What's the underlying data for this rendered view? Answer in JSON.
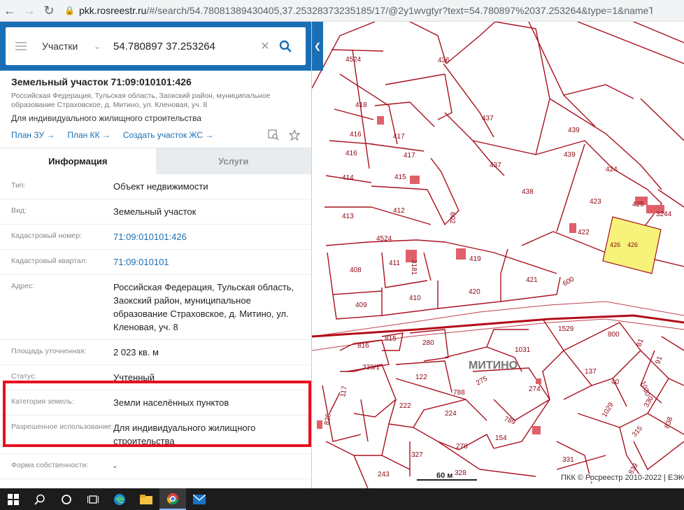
{
  "browser": {
    "url_host": "pkk.rosreestr.ru",
    "url_path": "/#/search/54.78081389430405,37.25328373235185/17/@2y1wvgtyr?text=54.780897%2037.253264&type=1&nameTab&i"
  },
  "search": {
    "type_label": "Участки",
    "query": "54.780897 37.253264"
  },
  "object": {
    "title": "Земельный участок 71:09:010101:426",
    "address_short": "Российская Федерация, Тульская область, Заокский район, муниципальное образование Страховское, д. Митино, ул. Кленовая, уч. 8",
    "use": "Для индивидуального жилищного строительства",
    "links": [
      "План ЗУ →",
      "План КК →",
      "Создать участок ЖС →"
    ]
  },
  "tabs": [
    "Информация",
    "Услуги"
  ],
  "info": [
    {
      "label": "Тип:",
      "value": "Объект недвижимости",
      "link": false
    },
    {
      "label": "Вид:",
      "value": "Земельный участок",
      "link": false
    },
    {
      "label": "Кадастровый номер:",
      "value": "71:09:010101:426",
      "link": true
    },
    {
      "label": "Кадастровый квартал:",
      "value": "71:09:010101",
      "link": true
    },
    {
      "label": "Адрес:",
      "value": "Российская Федерация, Тульская область, Заокский район, муниципальное образование Страховское, д. Митино, ул. Кленовая, уч. 8",
      "link": false
    },
    {
      "label": "Площадь уточненная:",
      "value": "2 023 кв. м",
      "link": false
    },
    {
      "label": "Статус:",
      "value": "Учтенный",
      "link": false
    },
    {
      "label": "Категория земель:",
      "value": "Земли населённых пунктов",
      "link": false
    },
    {
      "label": "Разрешенное использование:",
      "value": "Для индивидуального жилищного строительства",
      "link": false
    },
    {
      "label": "Форма собственности:",
      "value": "-",
      "link": false
    }
  ],
  "map": {
    "place_name": "МИТИНО",
    "scale_label": "60 м",
    "copyright": "ПКК © Росреестр 2010-2022 | ЕЭКО",
    "parcel_labels": [
      "4524",
      "436",
      "418",
      "416",
      "416",
      "417",
      "417",
      "437",
      "437",
      "439",
      "439",
      "424",
      "414",
      "415",
      "413",
      "412",
      "602",
      "438",
      "423",
      "425",
      "3244",
      "422",
      "426",
      "4524",
      "408",
      "411",
      "3181",
      "419",
      "421",
      "600",
      "409",
      "410",
      "420",
      "1529",
      "800",
      "81",
      "816",
      "815",
      "280",
      "1031",
      "137",
      "91",
      "338/1",
      "122",
      "275",
      "274",
      "40",
      "1030",
      "117",
      "788",
      "330",
      "222",
      "224",
      "789",
      "1029",
      "838",
      "825",
      "270",
      "154",
      "315",
      "327",
      "328",
      "331",
      "839",
      "243"
    ]
  },
  "colors": {
    "brand_blue": "#1a6fb4",
    "highlight_red": "#e8101e",
    "parcel_line": "#a8101e",
    "selected_fill": "#f7f27a"
  }
}
